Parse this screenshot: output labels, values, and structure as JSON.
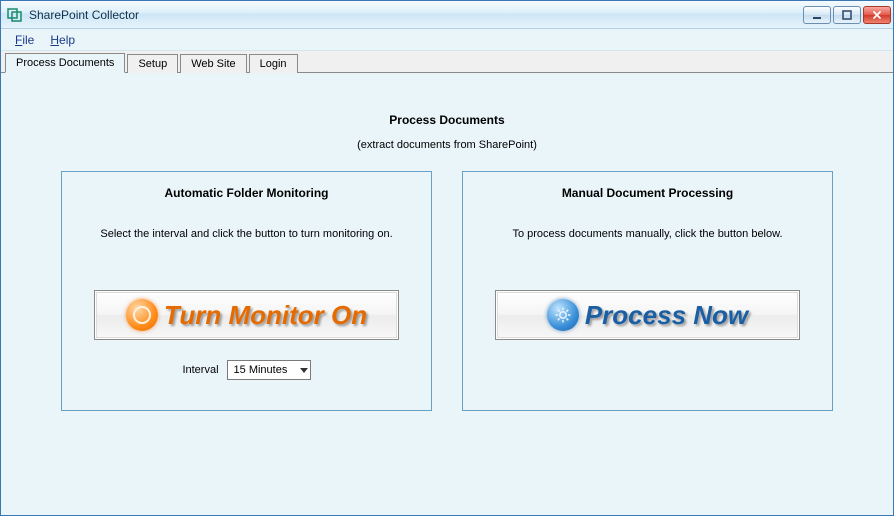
{
  "window": {
    "title": "SharePoint Collector"
  },
  "menus": {
    "file": "File",
    "help": "Help"
  },
  "tabs": {
    "process_documents": "Process Documents",
    "setup": "Setup",
    "web_site": "Web Site",
    "login": "Login"
  },
  "page": {
    "title": "Process Documents",
    "subtitle": "(extract documents from SharePoint)"
  },
  "auto_panel": {
    "title": "Automatic Folder Monitoring",
    "desc": "Select the interval and click the button to turn monitoring on.",
    "button_label": "Turn Monitor On",
    "interval_label": "Interval",
    "interval_value": "15 Minutes"
  },
  "manual_panel": {
    "title": "Manual Document Processing",
    "desc": "To process documents manually, click the button below.",
    "button_label": "Process Now"
  }
}
